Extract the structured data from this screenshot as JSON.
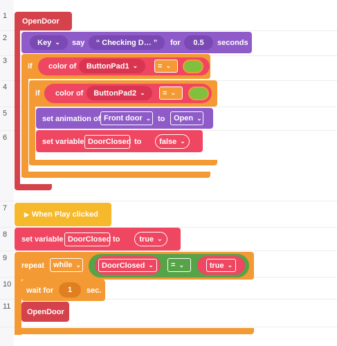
{
  "line_numbers": [
    "1",
    "2",
    "3",
    "4",
    "5",
    "6",
    "7",
    "8",
    "9",
    "10",
    "11"
  ],
  "colors": {
    "event_red": "#d5424b",
    "looks_purple": "#8e5bc9",
    "control_orange": "#f39a34",
    "variable_pink": "#ef4661",
    "hat_yellow": "#f6b92b",
    "operator_green": "#56a447",
    "swatch_green": "#80c03f"
  },
  "blocks": {
    "opendoor_header": "OpenDoor",
    "say": {
      "target": "Key",
      "verb": "say",
      "message": "“ Checking D… ”",
      "for_label": "for",
      "duration": "0.5",
      "unit": "seconds"
    },
    "if1": {
      "keyword": "if",
      "sensor_label": "color of",
      "sensor_target": "ButtonPad1",
      "operator": "=",
      "color_value": "green"
    },
    "if2": {
      "keyword": "if",
      "sensor_label": "color of",
      "sensor_target": "ButtonPad2",
      "operator": "=",
      "color_value": "green"
    },
    "set_animation": {
      "label": "set animation of",
      "target": "Front door",
      "to_label": "to",
      "value": "Open"
    },
    "set_variable_1": {
      "label": "set variable",
      "variable": "DoorClosed",
      "to_label": "to",
      "value": "false"
    },
    "when_play": {
      "icon": "play-triangle-icon",
      "label": "When Play clicked"
    },
    "set_variable_2": {
      "label": "set variable",
      "variable": "DoorClosed",
      "to_label": "to",
      "value": "true"
    },
    "repeat": {
      "label": "repeat",
      "mode": "while",
      "variable": "DoorClosed",
      "operator": "=",
      "value": "true"
    },
    "wait": {
      "label": "wait for",
      "value": "1",
      "unit": "sec."
    },
    "call_opendoor": "OpenDoor"
  }
}
